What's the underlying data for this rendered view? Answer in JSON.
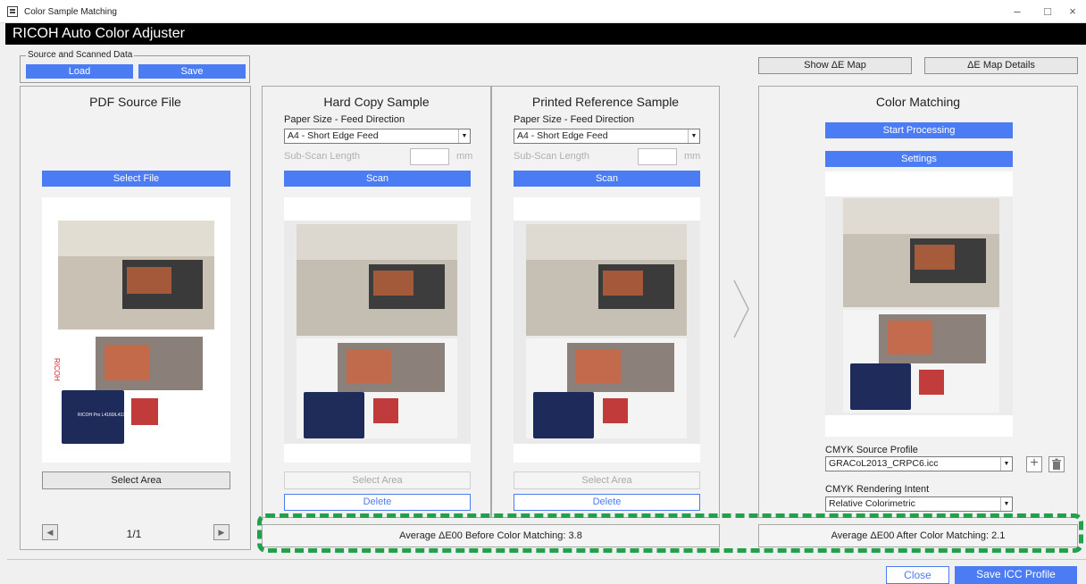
{
  "window": {
    "title": "Color Sample Matching",
    "minimize": "–",
    "maximize": "□",
    "close": "×"
  },
  "header": {
    "title": "RICOH Auto Color Adjuster"
  },
  "source_group": {
    "legend": "Source and Scanned Data",
    "load": "Load",
    "save": "Save"
  },
  "top_right": {
    "show_map": "Show ΔE Map",
    "map_details": "ΔE Map Details"
  },
  "pdf_panel": {
    "title": "PDF Source File",
    "select_file": "Select File",
    "select_area": "Select Area",
    "page": "1/1",
    "prev": "◀",
    "next": "▶"
  },
  "hard_copy": {
    "title": "Hard Copy Sample",
    "paper_label": "Paper Size - Feed Direction",
    "paper_value": "A4 - Short Edge Feed",
    "subscan_label": "Sub-Scan Length",
    "unit": "mm",
    "scan": "Scan",
    "select_area": "Select Area",
    "delete": "Delete"
  },
  "printed_ref": {
    "title": "Printed Reference Sample",
    "paper_label": "Paper Size - Feed Direction",
    "paper_value": "A4 - Short Edge Feed",
    "subscan_label": "Sub-Scan Length",
    "unit": "mm",
    "scan": "Scan",
    "select_area": "Select Area",
    "delete": "Delete"
  },
  "color_matching": {
    "title": "Color Matching",
    "start": "Start Processing",
    "settings": "Settings",
    "profile_label": "CMYK Source Profile",
    "profile_value": "GRACoL2013_CRPC6.icc",
    "intent_label": "CMYK Rendering Intent",
    "intent_value": "Relative Colorimetric"
  },
  "results": {
    "before": "Average ΔE00 Before Color Matching: 3.8",
    "after": "Average ΔE00 After Color Matching: 2.1"
  },
  "bottom": {
    "close": "Close",
    "save_icc": "Save ICC Profile"
  },
  "doc_text": {
    "brand": "RICOH",
    "product": "RICOH Pro L4160/L4130"
  },
  "colors": {
    "accent": "#4b7cf3",
    "highlight": "#22a04a"
  }
}
